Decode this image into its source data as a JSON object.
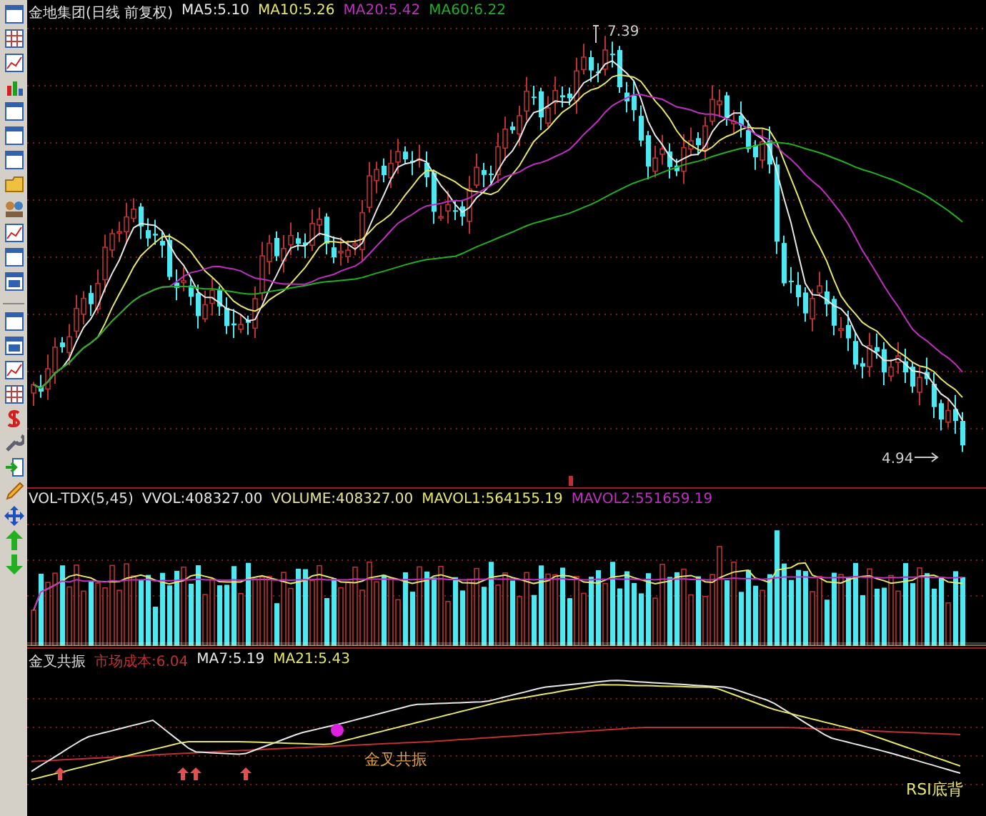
{
  "price_panel": {
    "title": "金地集团(日线 前复权)",
    "indicators": [
      {
        "label": "MA5:5.10",
        "color": "#e8e8e8"
      },
      {
        "label": "MA10:5.26",
        "color": "#e6e66a"
      },
      {
        "label": "MA20:5.42",
        "color": "#c030c0"
      },
      {
        "label": "MA60:6.22",
        "color": "#20b020"
      }
    ],
    "high_label": "7.39",
    "low_label": "4.94"
  },
  "volume_panel": {
    "title": "VOL-TDX(5,45)",
    "indicators": [
      {
        "label": "VVOL:408327.00",
        "color": "#e8e8e8"
      },
      {
        "label": "VOLUME:408327.00",
        "color": "#e6e6a0"
      },
      {
        "label": "MAVOL1:564155.19",
        "color": "#e6e66a"
      },
      {
        "label": "MAVOL2:551659.19",
        "color": "#c030c0"
      }
    ]
  },
  "signal_panel": {
    "title": "金叉共振",
    "indicators": [
      {
        "label": "市场成本:6.04",
        "color": "#c03030"
      },
      {
        "label": "MA7:5.19",
        "color": "#e8e8e8"
      },
      {
        "label": "MA21:5.43",
        "color": "#e6e66a"
      }
    ],
    "signals": [
      "金叉共振",
      "RSI底背"
    ]
  }
}
